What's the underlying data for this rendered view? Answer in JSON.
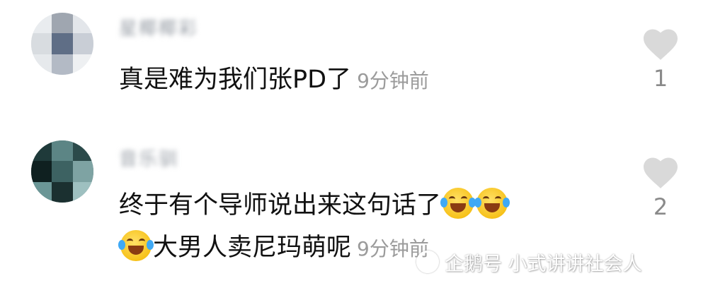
{
  "comments": [
    {
      "username": "星椰椰彩",
      "text": "真是难为我们张PD了",
      "time": "9分钟前",
      "likes": "1"
    },
    {
      "username": "音乐驯",
      "text_line1": "终于有个导师说出来这句话了",
      "text_line2": "大男人卖尼玛萌呢",
      "time": "9分钟前",
      "likes": "2"
    }
  ],
  "icons": {
    "like": "heart-icon",
    "emoji": "laughing-crying-emoji"
  },
  "colors": {
    "text": "#111111",
    "time": "#9b9b9b",
    "heart": "#d9d9d9",
    "like_count": "#8a8a8a"
  },
  "watermark": "企鹅号 小式讲讲社会人"
}
